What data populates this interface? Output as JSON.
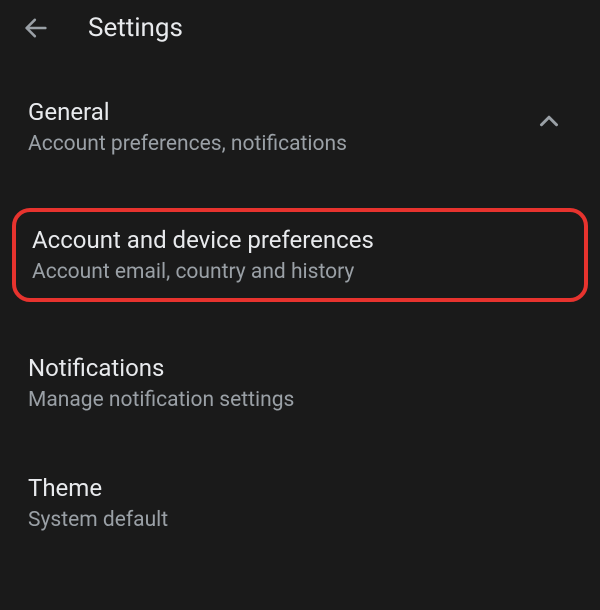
{
  "header": {
    "title": "Settings"
  },
  "sections": {
    "general": {
      "title": "General",
      "subtitle": "Account preferences, notifications"
    },
    "account": {
      "title": "Account and device preferences",
      "subtitle": "Account email, country and history"
    },
    "notifications": {
      "title": "Notifications",
      "subtitle": "Manage notification settings"
    },
    "theme": {
      "title": "Theme",
      "subtitle": "System default"
    }
  }
}
